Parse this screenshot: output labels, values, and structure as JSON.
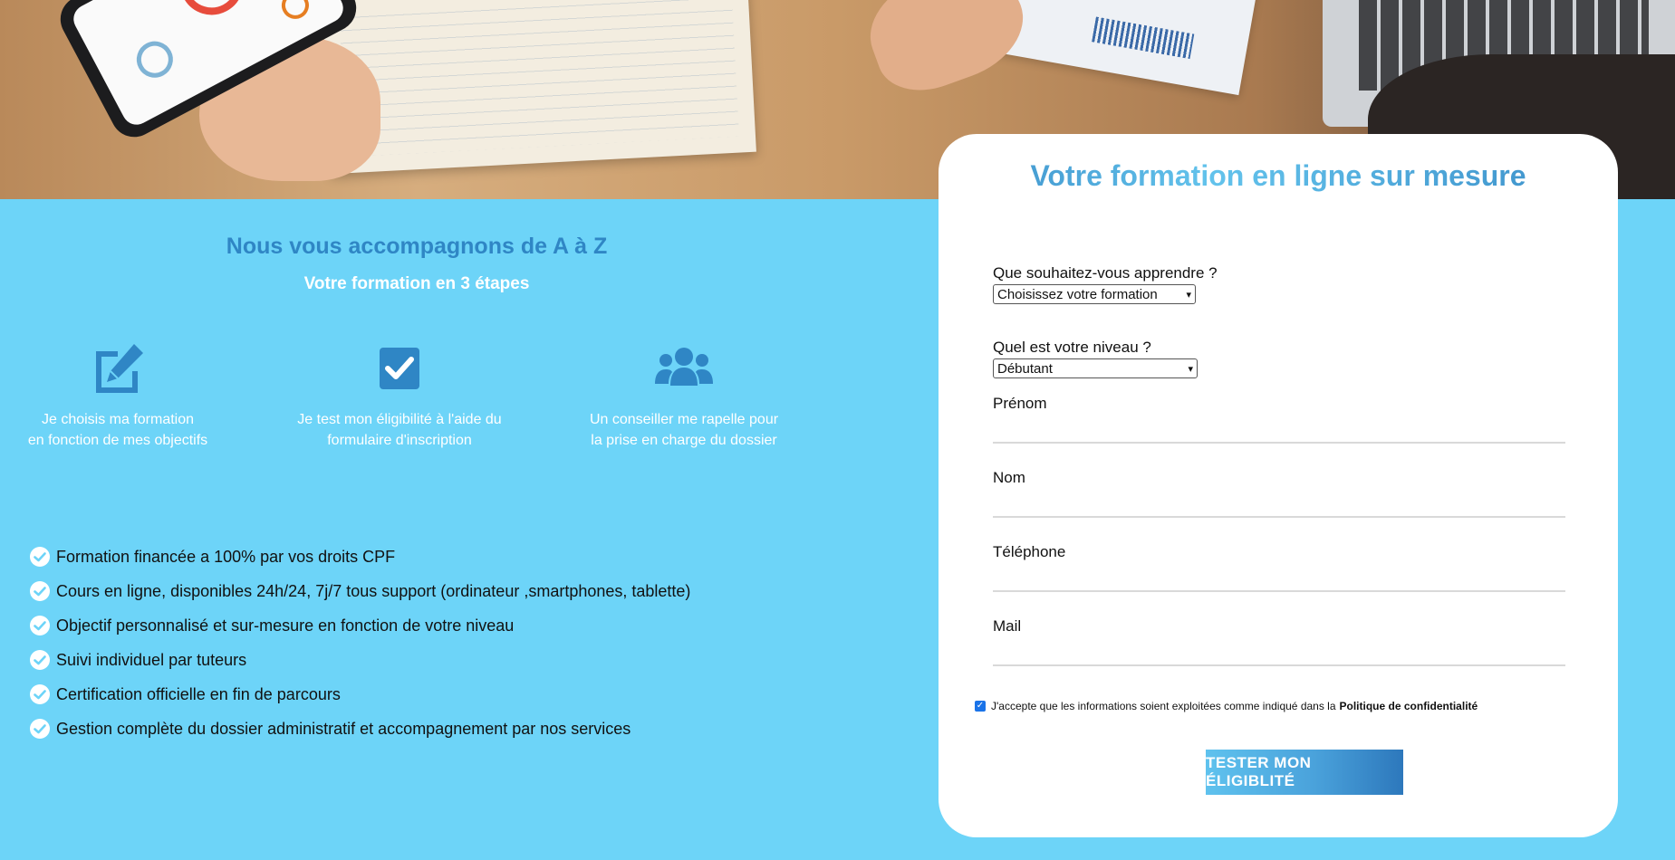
{
  "colors": {
    "page_background": "#6dd4f8",
    "accent_blue": "#2f86c5",
    "icon_blue": "#2f86c5",
    "card_background": "#ffffff",
    "button_gradient_start": "#5fc2ee",
    "button_gradient_end": "#2d78bc"
  },
  "hero": {
    "image": "photo of hands with a smartphone, notebook, charts and laptop on a wooden desk"
  },
  "steps_section": {
    "title": "Nous vous accompagnons de A à Z",
    "subtitle": "Votre formation en 3 étapes",
    "steps": [
      {
        "icon": "edit-icon",
        "text": "Je choisis ma formation\nen fonction de mes objectifs"
      },
      {
        "icon": "checkbox-icon",
        "text": "Je test mon éligibilité à l'aide du\nformulaire d'inscription"
      },
      {
        "icon": "users-icon",
        "text": "Un conseiller me rapelle pour\nla prise en charge du dossier"
      }
    ]
  },
  "features": [
    "Formation financée a 100% par vos droits CPF",
    "Cours en ligne, disponibles 24h/24, 7j/7 tous support (ordinateur ,smartphones, tablette)",
    "Objectif personnalisé et sur-mesure en fonction de votre niveau",
    "Suivi individuel par tuteurs",
    "Certification officielle en fin de parcours",
    "Gestion complète du dossier administratif et accompagnement par nos services"
  ],
  "form": {
    "title": "Votre formation en ligne sur mesure",
    "formation_label": "Que souhaitez-vous apprendre ?",
    "formation_select": "Choisissez votre formation",
    "level_label": "Quel est votre niveau ?",
    "level_select": "Débutant",
    "first_name_label": "Prénom",
    "last_name_label": "Nom",
    "phone_label": "Téléphone",
    "email_label": "Mail",
    "consent_checked": true,
    "consent_text": "J'accepte que les informations soient exploitées comme indiqué dans la",
    "consent_link": "Politique de confidentialité",
    "submit_label": "TESTER MON ÉLIGIBLITÉ"
  }
}
